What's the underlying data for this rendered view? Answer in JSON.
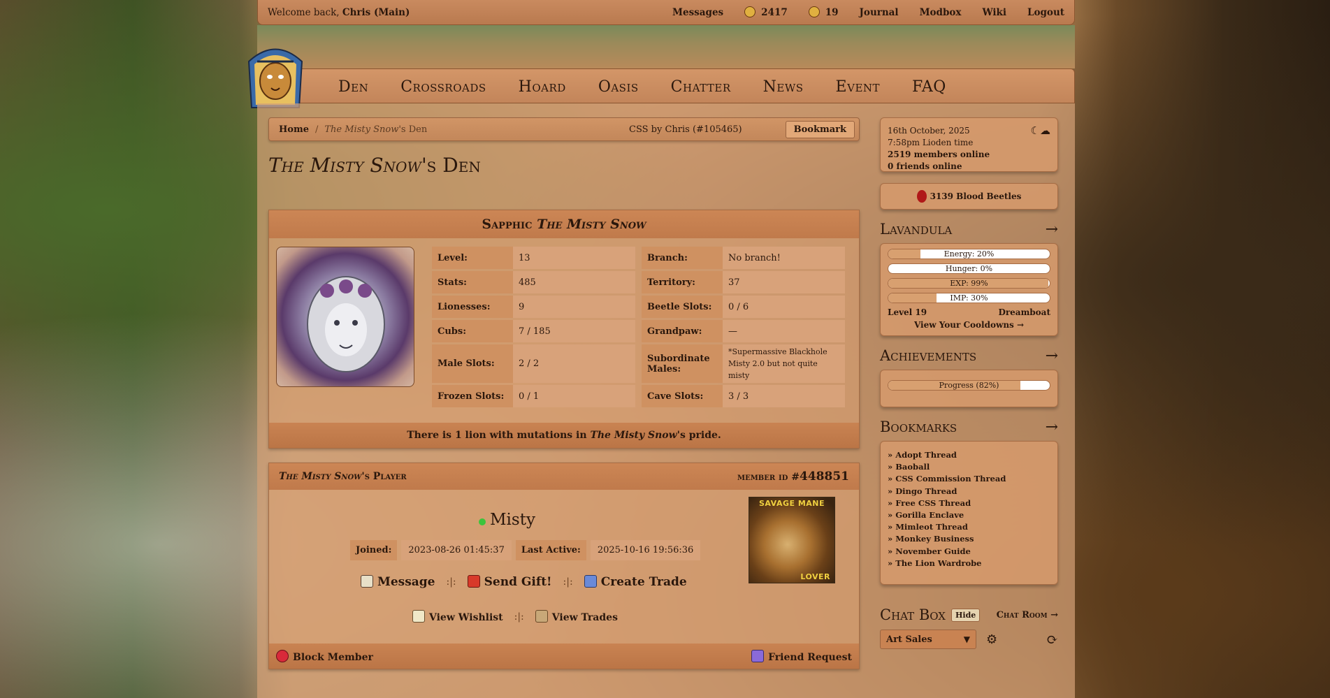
{
  "topbar": {
    "welcome": "Welcome back,",
    "user": "Chris (Main)",
    "links": [
      "Messages",
      "2417",
      "19",
      "Journal",
      "Modbox",
      "Wiki",
      "Logout"
    ]
  },
  "nav": [
    "Den",
    "Crossroads",
    "Hoard",
    "Oasis",
    "Chatter",
    "News",
    "Event",
    "FAQ"
  ],
  "breadcrumb": {
    "home": "Home",
    "sep": "/",
    "current_name": "The Misty Snow",
    "current_suffix": "'s Den",
    "css_credit": "CSS by Chris (#105465)",
    "bookmark": "Bookmark"
  },
  "page_title": {
    "name": "The Misty Snow",
    "suffix": "'s Den"
  },
  "pride": {
    "head_prefix": "Sapphic",
    "head_name": "The Misty Snow",
    "stats": [
      {
        "k": "Level:",
        "v": "13"
      },
      {
        "k": "Branch:",
        "v": "No branch!"
      },
      {
        "k": "Stats:",
        "v": "485"
      },
      {
        "k": "Territory:",
        "v": "37"
      },
      {
        "k": "Lionesses:",
        "v": "9"
      },
      {
        "k": "Beetle Slots:",
        "v": "0 / 6"
      },
      {
        "k": "Cubs:",
        "v": "7 / 185"
      },
      {
        "k": "Grandpaw:",
        "v": "—"
      },
      {
        "k": "Male Slots:",
        "v": "2 / 2"
      },
      {
        "k": "Subordinate Males:",
        "v": "*Supermassive Blackhole Misty 2.0 but not quite misty"
      },
      {
        "k": "Frozen Slots:",
        "v": "0 / 1"
      },
      {
        "k": "Cave Slots:",
        "v": "3 / 3"
      }
    ],
    "mutation_pre": "There is 1 lion with mutations in ",
    "mutation_name": "The Misty Snow",
    "mutation_post": "'s pride."
  },
  "player": {
    "head_name": "The Misty Snow",
    "head_suffix": "'s Player",
    "member_label": "member id #",
    "member_id": "448851",
    "name": "Misty",
    "joined_label": "Joined:",
    "joined": "2023-08-26 01:45:37",
    "active_label": "Last Active:",
    "active": "2025-10-16 19:56:36",
    "message": "Message",
    "gift": "Send Gift!",
    "trade": "Create Trade",
    "sep": ":|:",
    "wishlist": "View Wishlist",
    "trades": "View Trades",
    "block": "Block Member",
    "friend": "Friend Request",
    "badge_top": "SAVAGE MANE",
    "badge_bottom": "LOVER"
  },
  "sidebar": {
    "date": "16th October, 2025",
    "time": "7:58pm Lioden time",
    "online": "2519 members online",
    "friends": "0 friends online",
    "beetles": "3139 Blood Beetles",
    "lion_title": "Lavandula",
    "energy": {
      "label": "Energy: 20%",
      "pct": 20
    },
    "hunger": {
      "label": "Hunger: 0%",
      "pct": 0
    },
    "exp": {
      "label": "EXP: 99%",
      "pct": 99
    },
    "imp": {
      "label": "IMP: 30%",
      "pct": 30
    },
    "level": "Level 19",
    "activity": "Dreamboat",
    "cooldowns": "View Your Cooldowns →",
    "achievements_title": "Achievements",
    "progress": {
      "label": "Progress (82%)",
      "pct": 82
    },
    "bookmarks_title": "Bookmarks",
    "bookmarks": [
      "» Adopt Thread",
      "» Baoball",
      "» CSS Commission Thread",
      "» Dingo Thread",
      "» Free CSS Thread",
      "» Gorilla Enclave",
      "» Mimleot Thread",
      "» Monkey Business",
      "» November Guide",
      "» The Lion Wardrobe"
    ],
    "arrow": "→",
    "chat_title": "Chat Box",
    "chat_hide": "Hide",
    "chat_room": "Chat Room →",
    "chat_select": "Art Sales"
  },
  "colors": {
    "accent": "#c98352",
    "online": "#3cc43c"
  }
}
